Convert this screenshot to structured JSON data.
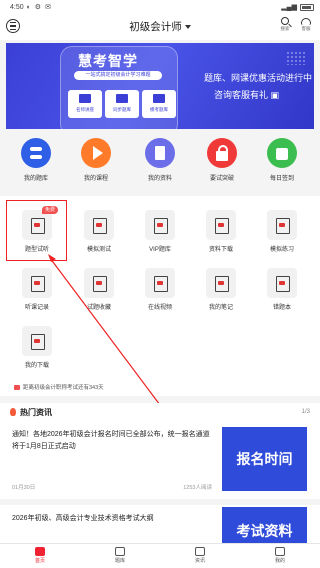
{
  "status_bar": {
    "time": "4:50"
  },
  "header": {
    "title": "初级会计师",
    "search_label": "搜索",
    "service_label": "客服"
  },
  "banner": {
    "brand": "慧考智学",
    "subtitle": "一站式搞定初级会计学习难题",
    "features": [
      "名师讲座",
      "同步题库",
      "模考题库"
    ],
    "promo_line1": "题库、网课优惠活动进行中",
    "promo_line2": "咨询客服有礼"
  },
  "quick_nav": [
    {
      "label": "我的题库",
      "icon": "question-bank-icon",
      "color": "#2f5fe6"
    },
    {
      "label": "我的课程",
      "icon": "play-icon",
      "color": "#ff7a29"
    },
    {
      "label": "我的资料",
      "icon": "document-icon",
      "color": "#6b6ee8"
    },
    {
      "label": "要试突破",
      "icon": "lock-icon",
      "color": "#f03a3a"
    },
    {
      "label": "每日签到",
      "icon": "shopping-bag-icon",
      "color": "#3cbd4f"
    }
  ],
  "grid": {
    "tag": "免费",
    "items": [
      {
        "label": "题型试听",
        "icon": "headphone-icon"
      },
      {
        "label": "模拟测试",
        "icon": "exam-icon"
      },
      {
        "label": "VIP题库",
        "icon": "vip-icon"
      },
      {
        "label": "资料下载",
        "icon": "download-doc-icon"
      },
      {
        "label": "模拟练习",
        "icon": "practice-icon"
      },
      {
        "label": "听课记录",
        "icon": "history-icon"
      },
      {
        "label": "试题收藏",
        "icon": "favorite-icon"
      },
      {
        "label": "在线视频",
        "icon": "cloud-icon"
      },
      {
        "label": "我的笔记",
        "icon": "note-icon"
      },
      {
        "label": "错题本",
        "icon": "wrong-answers-icon"
      },
      {
        "label": "我的下载",
        "icon": "download-icon"
      }
    ]
  },
  "notice": "距离初级会计职称考试还有343天",
  "news": {
    "title": "热门资讯",
    "page": "1/3",
    "article1": {
      "title": "通知！各地2026年初级会计报名时间已全部公布，统一报名通道将于1月8日正式启动",
      "date": "01月30日",
      "views": "1253人阅读",
      "thumb_text": "报名时间"
    },
    "article2": {
      "title": "2026年初级、高级会计专业技术资格考试大纲",
      "thumb_text": "考试资料"
    }
  },
  "bottom_nav": [
    {
      "label": "首页",
      "active": true
    },
    {
      "label": "题库",
      "active": false
    },
    {
      "label": "资讯",
      "active": false
    },
    {
      "label": "我的",
      "active": false
    }
  ]
}
